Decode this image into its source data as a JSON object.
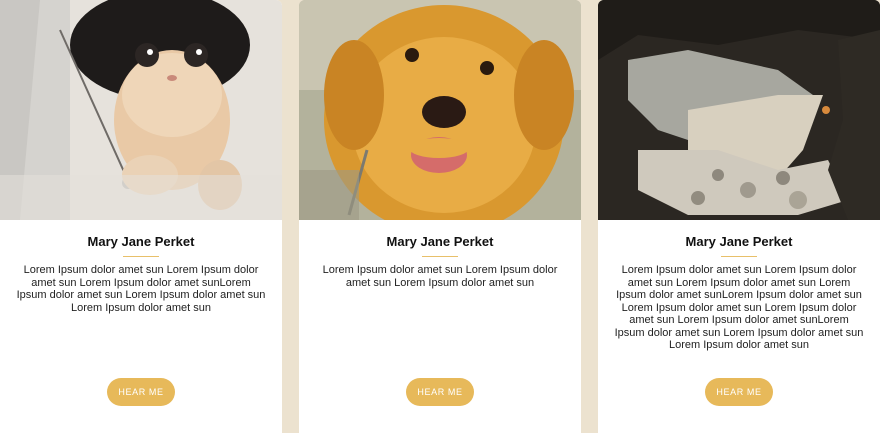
{
  "cards": [
    {
      "image": "kitten-photo",
      "name": "Mary Jane Perket",
      "description": "Lorem Ipsum dolor amet sun Lorem Ipsum dolor amet sun Lorem Ipsum dolor amet sunLorem Ipsum dolor amet sun Lorem Ipsum dolor amet sun Lorem Ipsum dolor amet sun",
      "button_label": "HEAR ME"
    },
    {
      "image": "puppy-photo",
      "name": "Mary Jane Perket",
      "description": "Lorem Ipsum dolor amet sun Lorem Ipsum dolor amet sun Lorem Ipsum dolor amet sun",
      "button_label": "HEAR ME"
    },
    {
      "image": "lake-photo",
      "name": "Mary Jane Perket",
      "description": "Lorem Ipsum dolor amet sun Lorem Ipsum dolor amet sun Lorem Ipsum dolor amet sun Lorem Ipsum dolor amet sunLorem Ipsum dolor amet sun Lorem Ipsum dolor amet sun Lorem Ipsum dolor amet sun Lorem Ipsum dolor amet sunLorem Ipsum dolor amet sun Lorem Ipsum dolor amet sun Lorem Ipsum dolor amet sun",
      "button_label": "HEAR ME"
    }
  ],
  "colors": {
    "page_background": "#ece2cf",
    "card_background": "#ffffff",
    "button": "#e7b95a",
    "divider": "#e8c06a"
  }
}
